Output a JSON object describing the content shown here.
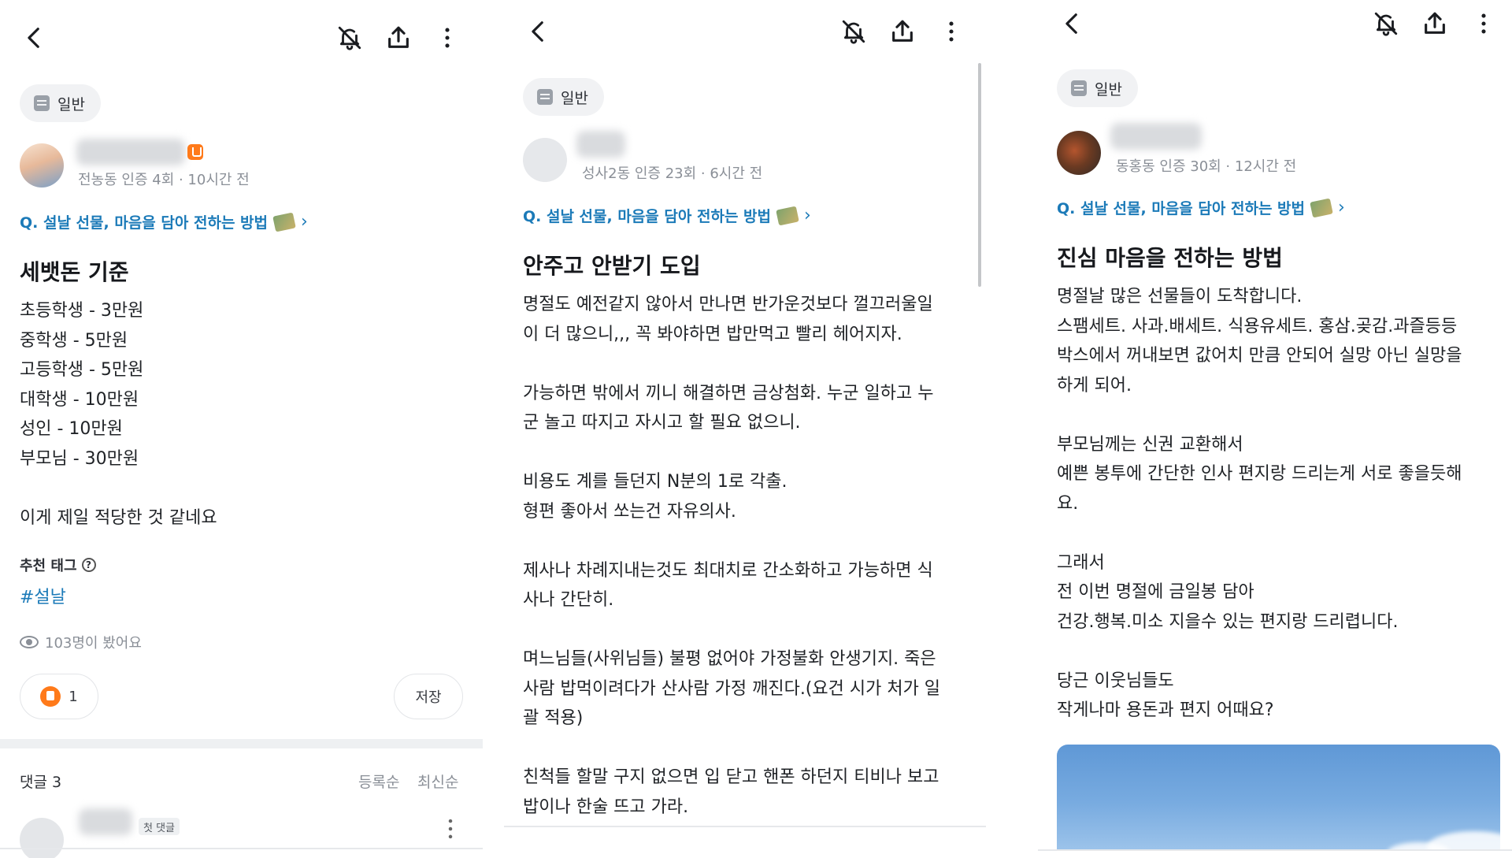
{
  "panels": [
    {
      "category": "일반",
      "meta": "전농동 인증 4회 · 10시간 전",
      "question": "Q. 설날 선물, 마음을 담아 전하는 방법",
      "title": "세뱃돈 기준",
      "body": "초등학생 - 3만원\n중학생 - 5만원\n고등학생 - 5만원\n대학생 - 10만원\n성인 - 10만원\n부모님 - 30만원\n\n이게 제일 적당한 것 같네요",
      "tags_label": "추천 태그",
      "tag": "#설날",
      "views": "103명이 봤어요",
      "likes": "1",
      "save_label": "저장",
      "comments_label": "댓글 3",
      "sort_registered": "등록순",
      "sort_latest": "최신순",
      "first_comment_badge": "첫 댓글"
    },
    {
      "category": "일반",
      "meta": "성사2동 인증 23회 · 6시간 전",
      "question": "Q. 설날 선물, 마음을 담아 전하는 방법",
      "title": "안주고 안받기 도입",
      "body": "명절도 예전같지 않아서 만나면 반가운것보다 껄끄러울일\n이 더 많으니,,, 꼭 봐야하면 밥만먹고 빨리 헤어지자.\n\n가능하면 밖에서 끼니 해결하면 금상첨화. 누군 일하고 누\n군 놀고 따지고 자시고 할 필요 없으니.\n\n비용도 계를 들던지 N분의 1로 각출.\n형편 좋아서 쏘는건 자유의사.\n\n제사나 차례지내는것도 최대치로 간소화하고 가능하면 식\n사나 간단히.\n\n며느님들(사위님들) 불평 없어야 가정불화 안생기지. 죽은\n사람 밥먹이려다가 산사람 가정 깨진다.(요건 시가 처가 일\n괄 적용)\n\n친척들 할말 구지 없으면 입 닫고 핸폰 하던지 티비나 보고\n밥이나 한술 뜨고 가라."
    },
    {
      "category": "일반",
      "meta": "동홍동 인증 30회 · 12시간 전",
      "question": "Q. 설날 선물, 마음을 담아 전하는 방법",
      "title": "진심 마음을 전하는 방법",
      "body": "명절날 많은 선물들이 도착합니다.\n스팸세트. 사과.배세트. 식용유세트. 홍삼.곶감.과즐등등\n박스에서 꺼내보면 값어치 만큼 안되어 실망 아닌 실망을\n하게 되어.\n\n부모님께는 신권 교환해서\n예쁜 봉투에 간단한 인사 편지랑 드리는게 서로 좋을듯해\n요.\n\n그래서\n전 이번 명절에 금일봉 담아\n건강.행복.미소 지을수 있는 편지랑 드리렵니다.\n\n당근 이웃님들도\n작게나마 용돈과 편지 어때요?"
    }
  ],
  "icons": {
    "back": "back-arrow-icon",
    "notify_off": "bell-off-icon",
    "share": "share-icon",
    "more": "more-vertical-icon"
  },
  "colors": {
    "link": "#1b7ab8",
    "like": "#ff7a1a",
    "chip_bg": "#f1f2f4",
    "meta": "#8a8f97"
  }
}
